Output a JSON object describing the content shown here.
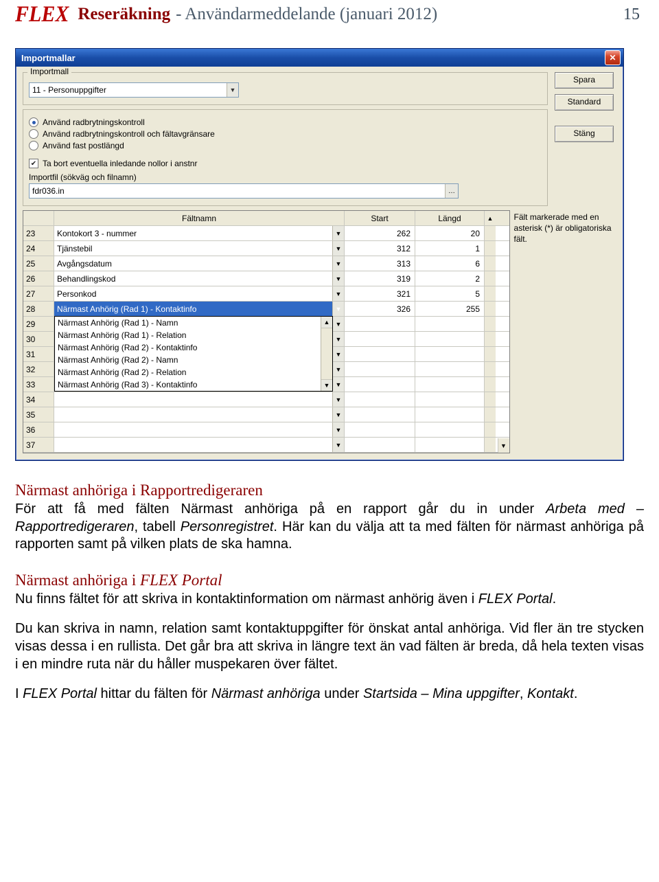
{
  "doc": {
    "logo": "FLEX",
    "title": "Reseräkning",
    "subtitle": "- Användarmeddelande (januari 2012)",
    "page_number": "15"
  },
  "dialog": {
    "title": "Importmallar",
    "group_importmall": "Importmall",
    "template_value": "11 - Personuppgifter",
    "buttons": {
      "save": "Spara",
      "standard": "Standard",
      "close": "Stäng"
    },
    "radios": {
      "r1": "Använd radbrytningskontroll",
      "r2": "Använd radbrytningskontroll och fältavgränsare",
      "r3": "Använd fast postlängd"
    },
    "checkbox": "Ta bort eventuella inledande nollor i anstnr",
    "importfile_label": "Importfil (sökväg och filnamn)",
    "importfile_value": "fdr036.in",
    "grid": {
      "headers": {
        "name": "Fältnamn",
        "start": "Start",
        "len": "Längd"
      },
      "rows": [
        {
          "num": "23",
          "name": "Kontokort 3 - nummer",
          "start": "262",
          "len": "20"
        },
        {
          "num": "24",
          "name": "Tjänstebil",
          "start": "312",
          "len": "1"
        },
        {
          "num": "25",
          "name": "Avgångsdatum",
          "start": "313",
          "len": "6"
        },
        {
          "num": "26",
          "name": "Behandlingskod",
          "start": "319",
          "len": "2"
        },
        {
          "num": "27",
          "name": "Personkod",
          "start": "321",
          "len": "5"
        },
        {
          "num": "28",
          "name": "Närmast Anhörig (Rad 1) - Kontaktinfo",
          "start": "326",
          "len": "255",
          "selected": true
        },
        {
          "num": "29",
          "name": "",
          "start": "",
          "len": ""
        },
        {
          "num": "30",
          "name": "",
          "start": "",
          "len": ""
        },
        {
          "num": "31",
          "name": "",
          "start": "",
          "len": ""
        },
        {
          "num": "32",
          "name": "",
          "start": "",
          "len": ""
        },
        {
          "num": "33",
          "name": "",
          "start": "",
          "len": ""
        },
        {
          "num": "34",
          "name": "",
          "start": "",
          "len": ""
        },
        {
          "num": "35",
          "name": "",
          "start": "",
          "len": ""
        },
        {
          "num": "36",
          "name": "",
          "start": "",
          "len": ""
        },
        {
          "num": "37",
          "name": "",
          "start": "",
          "len": ""
        }
      ],
      "dropdown_items": [
        "Närmast Anhörig (Rad 1) - Namn",
        "Närmast Anhörig (Rad 1) - Relation",
        "Närmast Anhörig (Rad 2) - Kontaktinfo",
        "Närmast Anhörig (Rad 2) - Namn",
        "Närmast Anhörig (Rad 2) - Relation",
        "Närmast Anhörig (Rad 3) - Kontaktinfo"
      ],
      "side_note": "Fält markerade med en asterisk (*) är obligatoriska fält."
    }
  },
  "body": {
    "h1": "Närmast anhöriga i Rapportredigeraren",
    "p1a": "För att få med fälten Närmast anhöriga på en rapport går du in under ",
    "p1b": "Arbeta med – Rapportredigeraren",
    "p1c": ", tabell ",
    "p1d": "Personregistret",
    "p1e": ". Här kan du välja att ta med fälten för närmast anhöriga på rapporten samt på vilken plats de ska hamna.",
    "h2a": "Närmast anhöriga i ",
    "h2b": "FLEX Portal",
    "p2a": "Nu finns fältet för att skriva in kontaktinformation om närmast anhörig även i ",
    "p2b": "FLEX Portal",
    "p2c": ".",
    "p3": "Du kan skriva in namn, relation samt kontaktuppgifter för önskat antal anhöriga. Vid fler än tre stycken visas dessa i en rullista. Det går bra att skriva in längre text än vad fälten är breda, då hela texten visas i en mindre ruta när du håller muspekaren över fältet.",
    "p4a": "I ",
    "p4b": "FLEX Portal",
    "p4c": " hittar du fälten för ",
    "p4d": "Närmast anhöriga",
    "p4e": " under ",
    "p4f": "Startsida – Mina uppgifter",
    "p4g": ", ",
    "p4h": "Kontakt",
    "p4i": "."
  }
}
